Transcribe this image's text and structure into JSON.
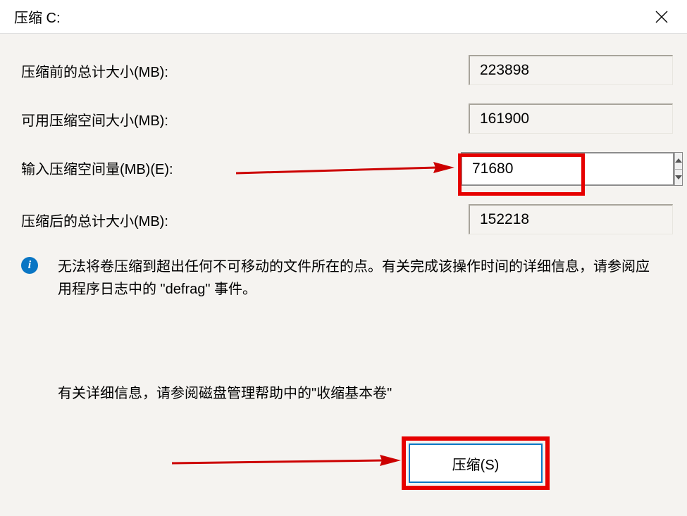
{
  "title": "压缩 C:",
  "fields": {
    "total_before": {
      "label": "压缩前的总计大小(MB):",
      "value": "223898"
    },
    "available": {
      "label": "可用压缩空间大小(MB):",
      "value": "161900"
    },
    "shrink_amount": {
      "label": "输入压缩空间量(MB)(E):",
      "value": "71680"
    },
    "total_after": {
      "label": "压缩后的总计大小(MB):",
      "value": "152218"
    }
  },
  "info_text": "无法将卷压缩到超出任何不可移动的文件所在的点。有关完成该操作时间的详细信息，请参阅应用程序日志中的 \"defrag\" 事件。",
  "help_text": "有关详细信息，请参阅磁盘管理帮助中的\"收缩基本卷\"",
  "buttons": {
    "shrink": "压缩(S)"
  }
}
